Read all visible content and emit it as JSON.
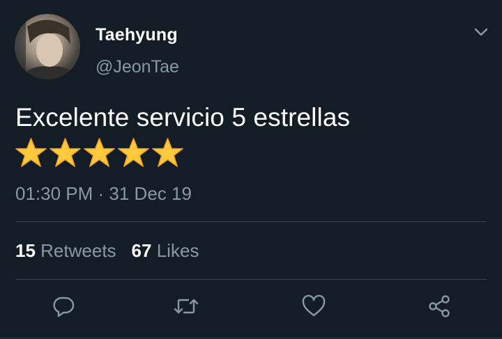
{
  "tweet": {
    "author_name": "Taehyung",
    "author_handle": "@JeonTae",
    "text": "Excelente servicio 5 estrellas",
    "emoji_stars": [
      "⭐",
      "⭐",
      "⭐",
      "⭐",
      "⭐"
    ],
    "timestamp": "01:30 PM · 31 Dec 19"
  },
  "stats": {
    "retweets_count": "15",
    "retweets_label": "Retweets",
    "likes_count": "67",
    "likes_label": "Likes"
  },
  "actions": {
    "reply_icon": "reply-icon",
    "retweet_icon": "retweet-icon",
    "like_icon": "heart-icon",
    "share_icon": "share-icon"
  },
  "colors": {
    "background": "#141d26",
    "primary_text": "#ffffff",
    "secondary_text": "#8899a6",
    "divider": "#38444d",
    "star": "#ffc83d"
  }
}
